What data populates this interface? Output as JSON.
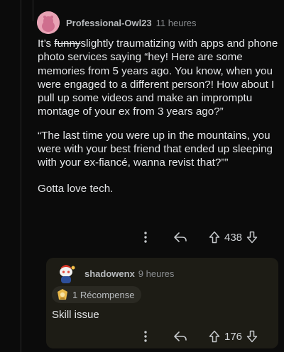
{
  "comment": {
    "username": "Professional-Owl23",
    "timestamp": "11 heures",
    "body": {
      "p1_lead": "It’s ",
      "p1_struck": "funny",
      "p1_rest": "slightly traumatizing with apps and phone photo services saying “hey! Here are some memories from 5 years ago. You know, when you were engaged to a different person?! How about I pull up some videos and make an impromptu montage of your ex from 3 years ago?”",
      "p2": "“The last time you were up in the mountains, you were with your best friend that ended up sleeping with your ex-fiancé, wanna revist that?””",
      "p3": "Gotta love tech."
    },
    "votes": "438"
  },
  "reply": {
    "username": "shadowenx",
    "timestamp": "9 heures",
    "award_label": "1 Récompense",
    "body": "Skill issue",
    "votes": "176"
  },
  "icons": {
    "more": "more-options-icon",
    "reply": "reply-arrow-icon",
    "upvote": "upvote-arrow-icon",
    "downvote": "downvote-arrow-icon",
    "award": "award-trophy-icon"
  },
  "colors": {
    "background": "#0b0b0b",
    "reply_card": "#1d1c15",
    "avatar_pink": "#e8a3b5",
    "award_gold": "#e8b84a"
  }
}
